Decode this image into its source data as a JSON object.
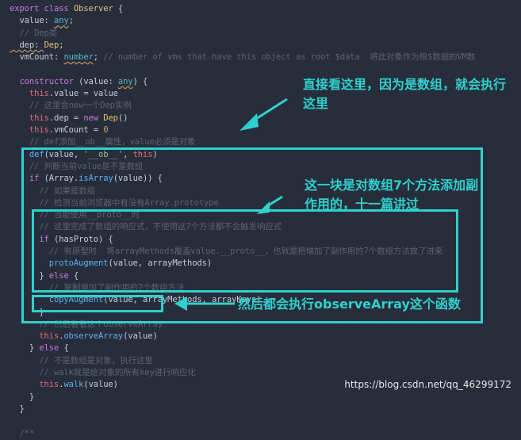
{
  "code": {
    "l01_kw": "export class ",
    "l01_cls": "Observer",
    "l01_rest": " {",
    "l02_name": "  value: ",
    "l02_type": "any",
    "l02_end": ";",
    "l03": "  // Dep类",
    "l04_name": "  dep: ",
    "l04_type": "Dep",
    "l04_end": ";",
    "l05_name": "  vmCount: ",
    "l05_type": "number",
    "l05_end": "; ",
    "l05_cm": "// number of vms that have this object as root $data  将此对象作为根$数据的VM数",
    "l07_kw": "  constructor",
    "l07_a": " (value: ",
    "l07_type": "any",
    "l07_b": ") {",
    "l08_this": "    this",
    "l08_rest": ".value = value",
    "l09": "    // 这里会new一个Dep实例",
    "l10_this": "    this",
    "l10_a": ".dep = ",
    "l10_kw": "new ",
    "l10_fn": "Dep",
    "l10_b": "()",
    "l11_this": "    this",
    "l11_a": ".vmCount = ",
    "l11_num": "0",
    "l12": "    // def添加__ob__属性，value必须是对象",
    "l13_fn": "    def",
    "l13_a": "(value, ",
    "l13_str": "'__ob__'",
    "l13_b": ", ",
    "l13_this": "this",
    "l13_c": ")",
    "l14": "    // 判断当前value是不是数组",
    "l15_kw": "    if ",
    "l15_a": "(Array.",
    "l15_fn": "isArray",
    "l15_b": "(value)) {",
    "l16": "      // 如果是数组",
    "l17": "      // 检测当前浏览器中有没有Array.prototype",
    "l18": "      // 当能使用__proto__时",
    "l19": "      // 这里完成了数组的响应式，不使用这7个方法都不会触发响应式",
    "l20_kw": "      if ",
    "l20_rest": "(hasProto) {",
    "l21": "        // 有原型时  将arrayMethods覆盖value.__proto__，也就是把增加了副作用的7个数组方法放了进来",
    "l22_fn": "        protoAugment",
    "l22_rest": "(value, arrayMethods)",
    "l23_a": "      } ",
    "l23_kw": "else",
    "l23_b": " {",
    "l24": "        // 复制增加了副作用的7个数组方法",
    "l25_fn": "        copyAugment",
    "l25_rest": "(value, arrayMethods, arrayKeys)",
    "l26": "      }",
    "l27": "      // 然后看看这个observeArray",
    "l28_this": "      this",
    "l28_a": ".",
    "l28_fn": "observeArray",
    "l28_b": "(value)",
    "l29_a": "    } ",
    "l29_kw": "else",
    "l29_b": " {",
    "l30": "      // 不是数组是对象，执行这里",
    "l31": "      // walk就是给对象的所有key进行响应化",
    "l32_this": "      this",
    "l32_a": ".",
    "l32_fn": "walk",
    "l32_b": "(value)",
    "l33": "    }",
    "l34": "  }",
    "l36": "  /**"
  },
  "annotations": {
    "top": "直接看这里，因为是数组，就会执行这里",
    "middle": "这一块是对数组7个方法添加副作用的，十一篇讲过",
    "bottom": "然后都会执行observeArray这个函数"
  },
  "watermark": "https://blog.csdn.net/qq_46299172",
  "colors": {
    "accent": "#2fd1cd",
    "background": "#272d3b"
  }
}
